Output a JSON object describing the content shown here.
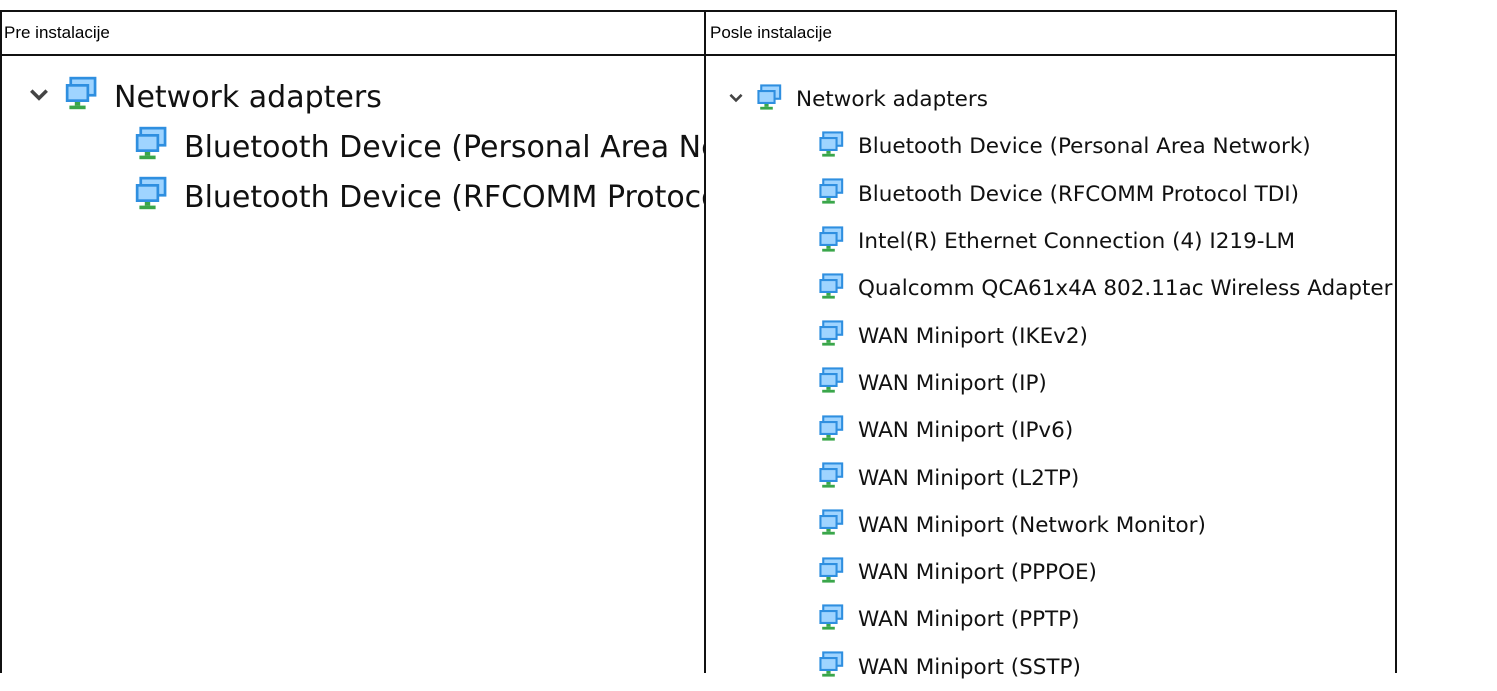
{
  "table": {
    "headers": {
      "before": "Pre instalacije",
      "after": "Posle instalacije"
    },
    "before": {
      "category": "Network adapters",
      "items": [
        "Bluetooth Device (Personal Area Network)",
        "Bluetooth Device (RFCOMM Protocol TDI)"
      ]
    },
    "after": {
      "category": "Network adapters",
      "items": [
        "Bluetooth Device (Personal Area Network)",
        "Bluetooth Device (RFCOMM Protocol TDI)",
        "Intel(R) Ethernet Connection (4) I219-LM",
        "Qualcomm QCA61x4A 802.11ac Wireless Adapter",
        "WAN Miniport (IKEv2)",
        "WAN Miniport (IP)",
        "WAN Miniport (IPv6)",
        "WAN Miniport (L2TP)",
        "WAN Miniport (Network Monitor)",
        "WAN Miniport (PPPOE)",
        "WAN Miniport (PPTP)",
        "WAN Miniport (SSTP)"
      ]
    }
  },
  "icons": {
    "expand": "chevron-down-icon",
    "adapter": "network-adapter-icon"
  },
  "colors": {
    "monitor_blue": "#2f8fe0",
    "monitor_light": "#9fd4ff",
    "stand_green": "#3aa64a",
    "border": "#111111"
  }
}
